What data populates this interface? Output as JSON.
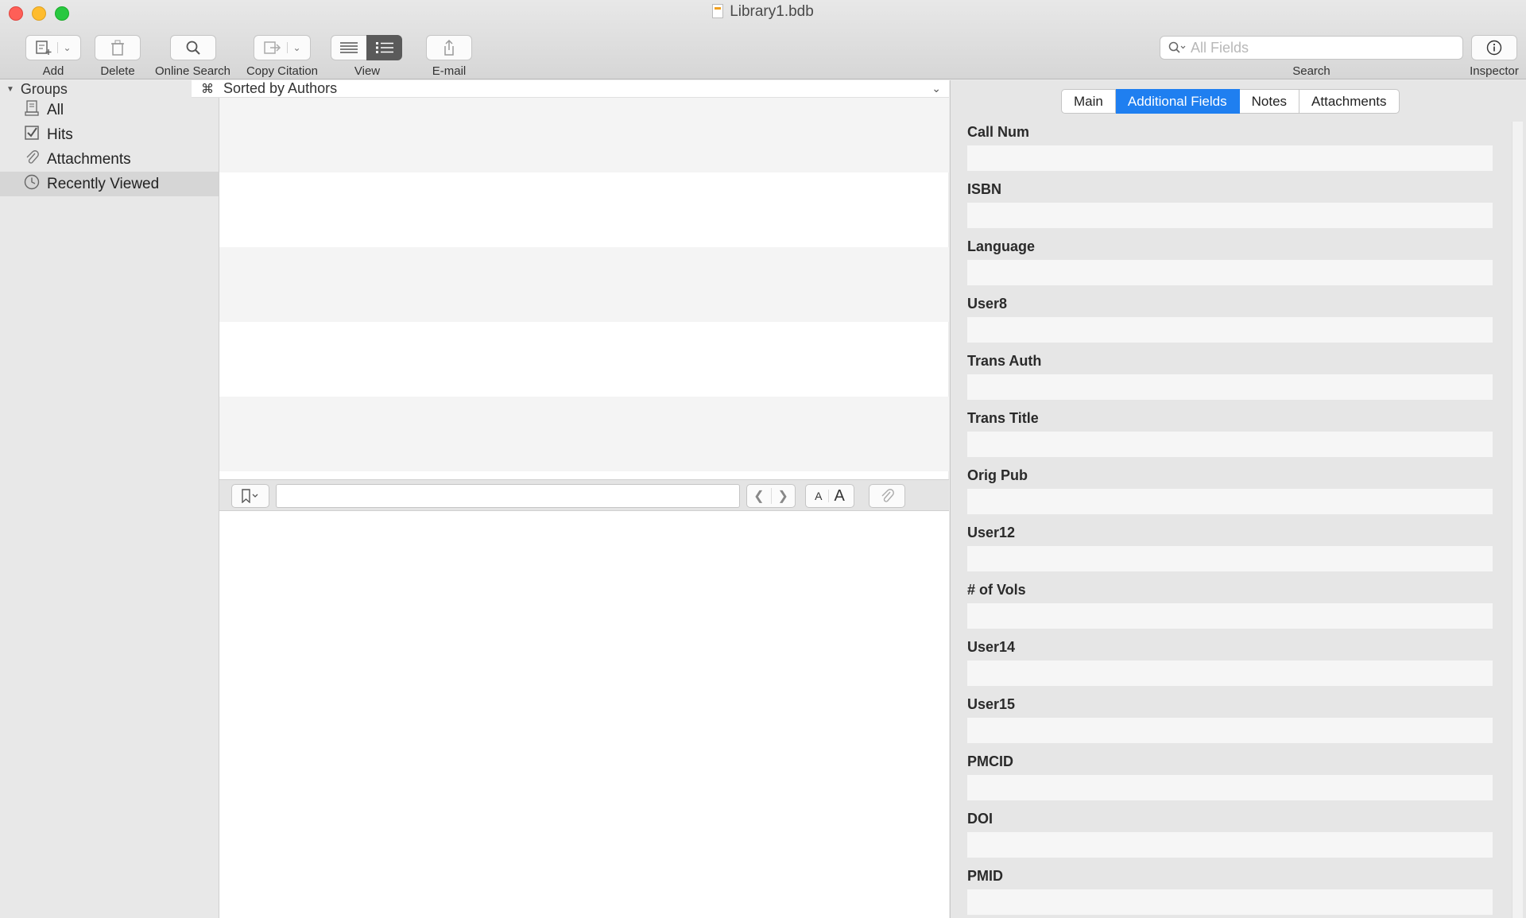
{
  "window": {
    "title": "Library1.bdb"
  },
  "toolbar": {
    "add_label": "Add",
    "delete_label": "Delete",
    "online_search_label": "Online Search",
    "copy_citation_label": "Copy Citation",
    "view_label": "View",
    "email_label": "E-mail",
    "search_placeholder": "All Fields",
    "search_label": "Search",
    "inspector_label": "Inspector"
  },
  "sidebar": {
    "header": "Groups",
    "items": [
      {
        "label": "All",
        "icon": "library-icon"
      },
      {
        "label": "Hits",
        "icon": "checkbox-icon"
      },
      {
        "label": "Attachments",
        "icon": "paperclip-icon"
      },
      {
        "label": "Recently Viewed",
        "icon": "clock-icon",
        "selected": true
      }
    ]
  },
  "list": {
    "sort_label": "Sorted by Authors"
  },
  "inspector": {
    "tabs": [
      {
        "label": "Main"
      },
      {
        "label": "Additional Fields",
        "active": true
      },
      {
        "label": "Notes"
      },
      {
        "label": "Attachments"
      }
    ],
    "fields": [
      {
        "label": "Call Num",
        "value": ""
      },
      {
        "label": "ISBN",
        "value": ""
      },
      {
        "label": "Language",
        "value": ""
      },
      {
        "label": "User8",
        "value": ""
      },
      {
        "label": "Trans Auth",
        "value": ""
      },
      {
        "label": "Trans Title",
        "value": ""
      },
      {
        "label": "Orig Pub",
        "value": ""
      },
      {
        "label": "User12",
        "value": ""
      },
      {
        "label": "# of Vols",
        "value": ""
      },
      {
        "label": "User14",
        "value": ""
      },
      {
        "label": "User15",
        "value": ""
      },
      {
        "label": "PMCID",
        "value": ""
      },
      {
        "label": "DOI",
        "value": ""
      },
      {
        "label": "PMID",
        "value": ""
      }
    ]
  },
  "colors": {
    "accent": "#1f7ff0"
  }
}
